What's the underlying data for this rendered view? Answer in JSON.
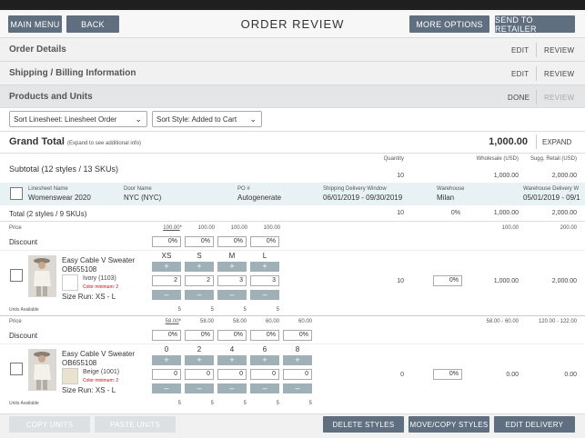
{
  "header": {
    "title": "ORDER REVIEW",
    "main_menu": "MAIN MENU",
    "back": "BACK",
    "more_options": "MORE OPTIONS",
    "send_to_retailer": "SEND TO RETAILER"
  },
  "sections": {
    "order_details": {
      "label": "Order Details",
      "edit": "EDIT",
      "review": "REVIEW"
    },
    "shipping": {
      "label": "Shipping / Billing Information",
      "edit": "EDIT",
      "review": "REVIEW"
    },
    "products": {
      "label": "Products and Units",
      "done": "DONE",
      "review": "REVIEW"
    }
  },
  "sorts": {
    "linesheet": "Sort Linesheet: Linesheet Order",
    "style": "Sort Style: Added to Cart"
  },
  "grand_total": {
    "label": "Grand Total",
    "hint": "(Expand to see additional info)",
    "value": "1,000.00",
    "expand": "EXPAND"
  },
  "subtotal": {
    "label": "Subtotal (12 styles / 13 SKUs)",
    "qty_header": "Quantity",
    "qty": "10",
    "wholesale_header": "Wholesale (USD)",
    "wholesale": "1,000.00",
    "retail_header": "Sugg. Retail (USD)",
    "retail": "2,000.00"
  },
  "linesheet": {
    "name_label": "Linesheet Name",
    "name": "Womenswear 2020",
    "door_label": "Door Name",
    "door": "NYC (NYC)",
    "po_label": "PO #",
    "po": "Autogenerate",
    "window_label": "Shipping Delivery Window",
    "window": "06/01/2019 - 09/30/2019",
    "warehouse_label": "Warehouse",
    "warehouse": "Milan",
    "wdelivery_label": "Warehouse Delivery W",
    "wdelivery": "05/01/2019 - 09/1"
  },
  "ls_total": {
    "label": "Total (2 styles / 9 SKUs)",
    "qty": "10",
    "disc": "0%",
    "wholesale": "1,000.00",
    "retail": "2,000.00"
  },
  "product1": {
    "price_label": "Price",
    "prices": [
      "100.00*",
      "100.00",
      "100.00",
      "100.00"
    ],
    "price_wholesale": "100.00",
    "price_retail": "200.00",
    "discount_label": "Discount",
    "discounts": [
      "0%",
      "0%",
      "0%",
      "0%"
    ],
    "name": "Easy Cable V Sweater",
    "sku": "OB655108",
    "color": "Ivory (1103)",
    "color_min": "Color minimum: 2",
    "size_run": "Size Run: XS - L",
    "sizes": [
      "XS",
      "S",
      "M",
      "L"
    ],
    "qtys": [
      "2",
      "2",
      "3",
      "3"
    ],
    "total_qty": "10",
    "disc": "0%",
    "wholesale": "1,000.00",
    "retail": "2,000.00",
    "units_label": "Units Available",
    "units": [
      "5",
      "5",
      "5",
      "5"
    ]
  },
  "product2": {
    "price_label": "Price",
    "prices": [
      "58.00*",
      "58.00",
      "58.00",
      "60.00",
      "60.00"
    ],
    "price_wholesale": "58.00 - 60.00",
    "price_retail": "120.00 - 122.00",
    "discount_label": "Discount",
    "discounts": [
      "0%",
      "0%",
      "0%",
      "0%",
      "0%"
    ],
    "name": "Easy Cable V Sweater",
    "sku": "OB655108",
    "color": "Beige (1001)",
    "color_min": "Color minimum: 2",
    "size_run": "Size Run: XS - L",
    "sizes": [
      "0",
      "2",
      "4",
      "6",
      "8"
    ],
    "qtys": [
      "0",
      "0",
      "0",
      "0",
      "0"
    ],
    "total_qty": "0",
    "disc": "0%",
    "wholesale": "0.00",
    "retail": "0.00",
    "units_label": "Units Available",
    "units": [
      "5",
      "5",
      "5",
      "5",
      "5"
    ]
  },
  "footer": {
    "copy_units": "COPY UNITS",
    "paste_units": "PASTE UNITS",
    "delete_styles": "DELETE STYLES",
    "move_copy": "MOVE/COPY STYLES",
    "edit_delivery": "EDIT DELIVERY"
  },
  "colors": {
    "button": "#5f6f80",
    "stepper": "#9fb1b6",
    "section_bg": "#f1f1f1",
    "linesheet_bg": "#e8f1f3",
    "required": "#d0021b"
  }
}
